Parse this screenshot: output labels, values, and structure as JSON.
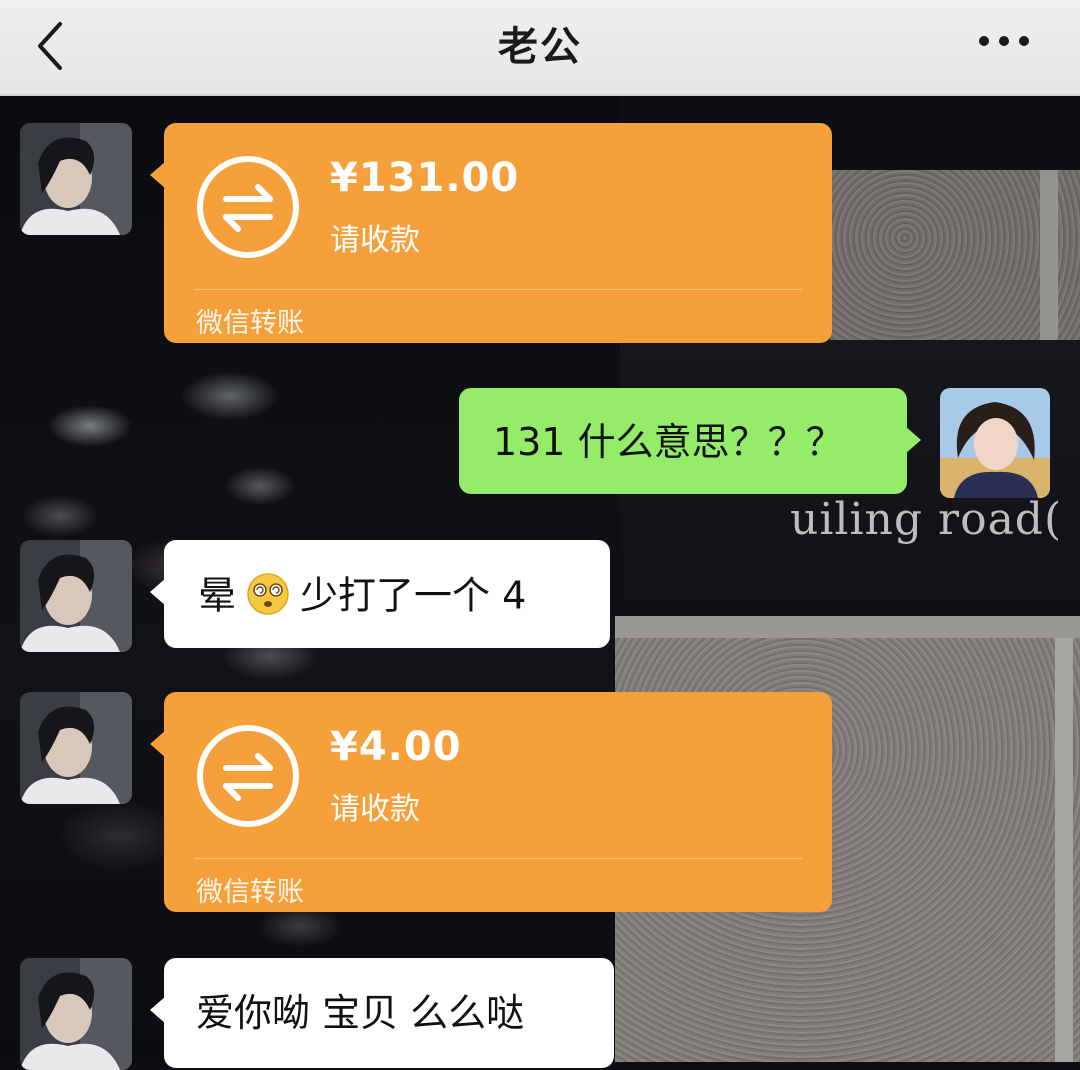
{
  "header": {
    "title": "老公",
    "back_icon": "chevron-left-icon",
    "more_icon": "more-dots-icon"
  },
  "background": {
    "sign_text": "uiling road("
  },
  "messages": [
    {
      "sender": "him",
      "type": "transfer",
      "amount": "¥131.00",
      "status": "请收款",
      "footer": "微信转账"
    },
    {
      "sender": "me",
      "type": "text",
      "text": "131 什么意思？？？"
    },
    {
      "sender": "him",
      "type": "text",
      "text_before": "晕",
      "emoji": "dizzy-face-emoji",
      "text_after": "少打了一个 4"
    },
    {
      "sender": "him",
      "type": "transfer",
      "amount": "¥4.00",
      "status": "请收款",
      "footer": "微信转账"
    },
    {
      "sender": "him",
      "type": "text",
      "text": "爱你呦 宝贝 么么哒"
    }
  ],
  "colors": {
    "transfer_bubble": "#f6a03b",
    "my_bubble": "#95ec69",
    "their_bubble": "#ffffff",
    "header_bg": "#ececec"
  }
}
